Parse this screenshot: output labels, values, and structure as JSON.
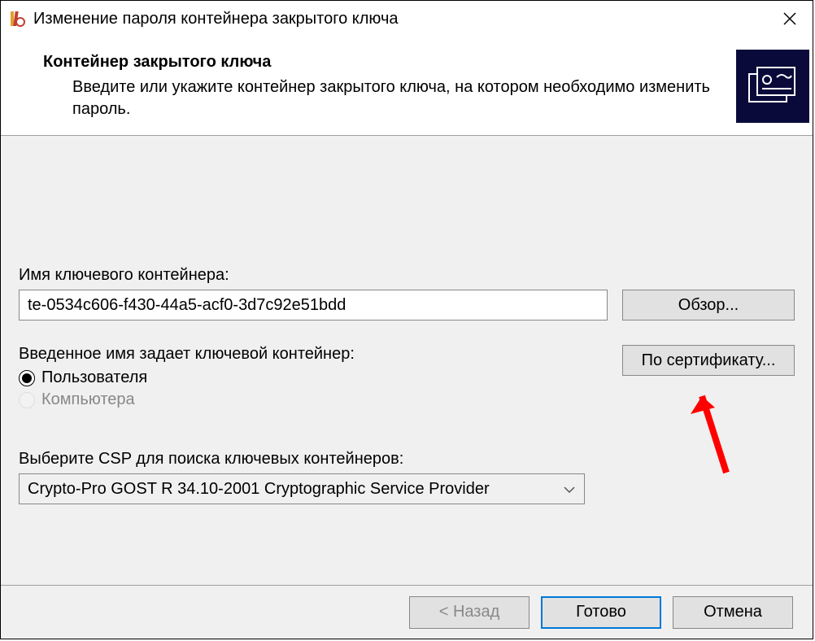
{
  "window": {
    "title": "Изменение пароля контейнера закрытого ключа"
  },
  "header": {
    "title": "Контейнер закрытого ключа",
    "description": "Введите или укажите контейнер закрытого ключа, на котором необходимо изменить пароль."
  },
  "container": {
    "name_label": "Имя ключевого контейнера:",
    "name_value": "te-0534c606-f430-44a5-acf0-3d7c92e51bdd",
    "browse_label": "Обзор...",
    "by_cert_label": "По сертификату..."
  },
  "scope": {
    "label": "Введенное имя задает ключевой контейнер:",
    "user_label": "Пользователя",
    "computer_label": "Компьютера",
    "selected": "user"
  },
  "csp": {
    "label": "Выберите CSP для поиска ключевых контейнеров:",
    "selected": "Crypto-Pro GOST R 34.10-2001 Cryptographic Service Provider"
  },
  "footer": {
    "back_label": "< Назад",
    "finish_label": "Готово",
    "cancel_label": "Отмена"
  }
}
